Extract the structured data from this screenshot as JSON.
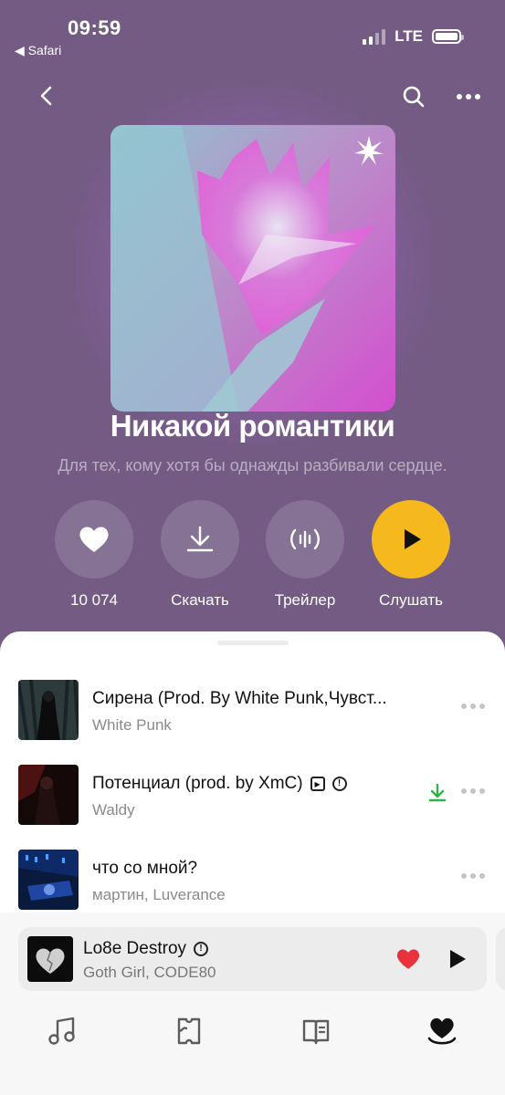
{
  "status_bar": {
    "time": "09:59",
    "back_app": "◀ Safari",
    "network": "LTE"
  },
  "playlist": {
    "title": "Никакой романтики",
    "description": "Для тех, кому хотя бы однажды разбивали сердце."
  },
  "actions": {
    "likes_count": "10 074",
    "download_label": "Скачать",
    "trailer_label": "Трейлер",
    "listen_label": "Слушать"
  },
  "tracks": [
    {
      "title": "Сирена (Prod. By White Punk,Чувст...",
      "artist": "White Punk"
    },
    {
      "title": "Потенциал (prod. by XmC)",
      "artist": "Waldy"
    },
    {
      "title": "что со мной?",
      "artist": "мартин, Luverance"
    }
  ],
  "now_playing": {
    "title": "Lo8e Destroy",
    "artist": "Goth Girl, CODE80"
  },
  "tabs": [
    "music-icon",
    "map-icon",
    "book-icon",
    "heart-collection-icon"
  ],
  "colors": {
    "background": "#735b83",
    "play_button": "#f5b81d",
    "heart": "#e8323c",
    "download_done": "#2fb344"
  }
}
